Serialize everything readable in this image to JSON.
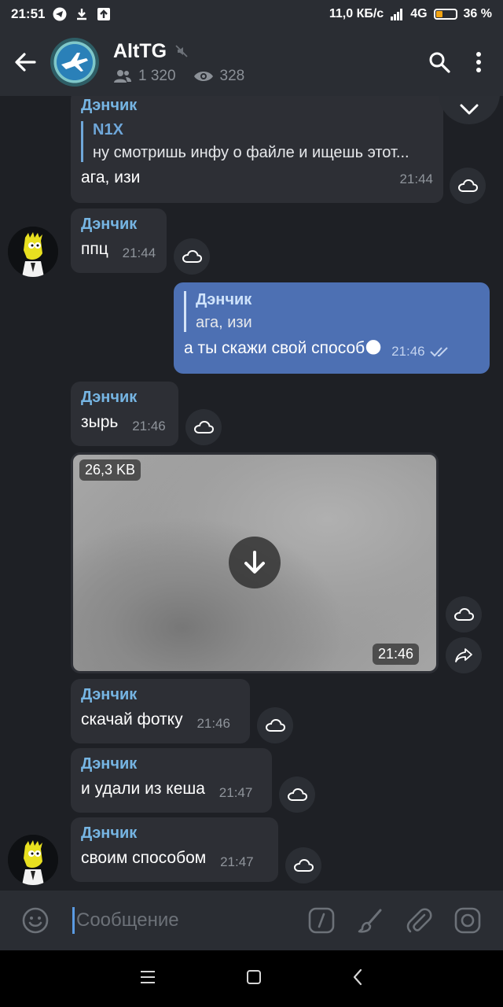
{
  "statusbar": {
    "time": "21:51",
    "network": "11,0 КБ/с",
    "signal": "4G",
    "battery": "36 %"
  },
  "header": {
    "title": "AltTG",
    "members": "1 320",
    "views": "328"
  },
  "messages": [
    {
      "sender": "Дэнчик",
      "reply_name": "N1X",
      "reply_text": "ну смотришь инфу о файле и ищешь этот...",
      "text": "ага, изи",
      "time": "21:44"
    },
    {
      "sender": "Дэнчик",
      "text": "ппц",
      "time": "21:44"
    },
    {
      "reply_name": "Дэнчик",
      "reply_text": "ага, изи",
      "text": "а ты скажи свой способ🌑",
      "time": "21:46"
    },
    {
      "sender": "Дэнчик",
      "text": "зырь",
      "time": "21:46"
    },
    {
      "photo_size": "26,3 KB",
      "time": "21:46"
    },
    {
      "sender": "Дэнчик",
      "text": "скачай фотку",
      "time": "21:46"
    },
    {
      "sender": "Дэнчик",
      "text": "и удали из кеша",
      "time": "21:47"
    },
    {
      "sender": "Дэнчик",
      "text": "своим способом",
      "time": "21:47"
    }
  ],
  "composer": {
    "placeholder": "Сообщение"
  },
  "colors": {
    "accent": "#76b5e3",
    "outgoing": "#4d70b3",
    "incoming": "#2d2f35"
  }
}
